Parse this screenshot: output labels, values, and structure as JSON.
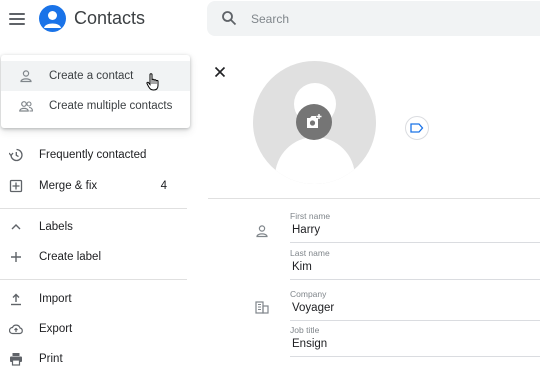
{
  "header": {
    "app_title": "Contacts",
    "search_placeholder": "Search"
  },
  "dropdown": {
    "items": [
      {
        "label": "Create a contact",
        "icon": "person-icon"
      },
      {
        "label": "Create multiple contacts",
        "icon": "people-icon"
      }
    ]
  },
  "sidebar": {
    "frequently_contacted": "Frequently contacted",
    "merge_fix": "Merge & fix",
    "merge_fix_count": "4",
    "labels": "Labels",
    "create_label": "Create label",
    "import": "Import",
    "export": "Export",
    "print": "Print"
  },
  "form": {
    "first_name_label": "First name",
    "first_name_value": "Harry",
    "last_name_label": "Last name",
    "last_name_value": "Kim",
    "company_label": "Company",
    "company_value": "Voyager",
    "job_title_label": "Job title",
    "job_title_value": "Ensign"
  },
  "colors": {
    "accent": "#1a73e8",
    "icon_grey": "#5f6368",
    "avatar_bg": "#e0e0e0",
    "camera_bg": "#757575"
  }
}
